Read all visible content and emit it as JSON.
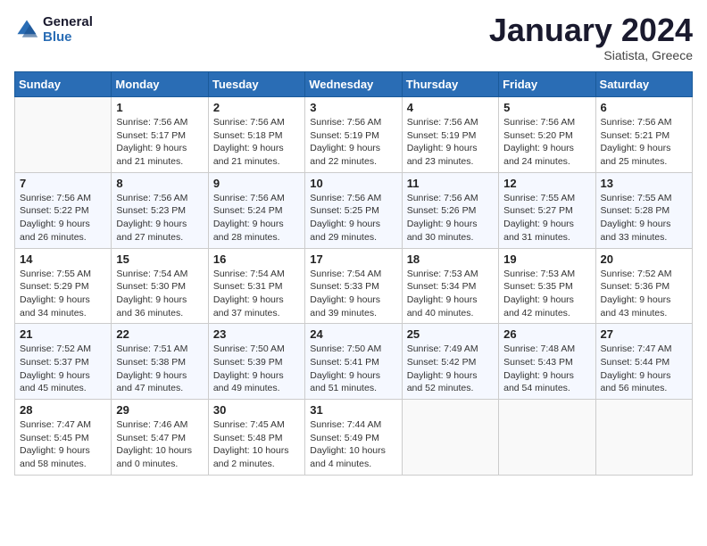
{
  "app": {
    "logo_line1": "General",
    "logo_line2": "Blue"
  },
  "title": "January 2024",
  "subtitle": "Siatista, Greece",
  "days_of_week": [
    "Sunday",
    "Monday",
    "Tuesday",
    "Wednesday",
    "Thursday",
    "Friday",
    "Saturday"
  ],
  "weeks": [
    [
      {
        "num": "",
        "sunrise": "",
        "sunset": "",
        "daylight": ""
      },
      {
        "num": "1",
        "sunrise": "Sunrise: 7:56 AM",
        "sunset": "Sunset: 5:17 PM",
        "daylight": "Daylight: 9 hours and 21 minutes."
      },
      {
        "num": "2",
        "sunrise": "Sunrise: 7:56 AM",
        "sunset": "Sunset: 5:18 PM",
        "daylight": "Daylight: 9 hours and 21 minutes."
      },
      {
        "num": "3",
        "sunrise": "Sunrise: 7:56 AM",
        "sunset": "Sunset: 5:19 PM",
        "daylight": "Daylight: 9 hours and 22 minutes."
      },
      {
        "num": "4",
        "sunrise": "Sunrise: 7:56 AM",
        "sunset": "Sunset: 5:19 PM",
        "daylight": "Daylight: 9 hours and 23 minutes."
      },
      {
        "num": "5",
        "sunrise": "Sunrise: 7:56 AM",
        "sunset": "Sunset: 5:20 PM",
        "daylight": "Daylight: 9 hours and 24 minutes."
      },
      {
        "num": "6",
        "sunrise": "Sunrise: 7:56 AM",
        "sunset": "Sunset: 5:21 PM",
        "daylight": "Daylight: 9 hours and 25 minutes."
      }
    ],
    [
      {
        "num": "7",
        "sunrise": "Sunrise: 7:56 AM",
        "sunset": "Sunset: 5:22 PM",
        "daylight": "Daylight: 9 hours and 26 minutes."
      },
      {
        "num": "8",
        "sunrise": "Sunrise: 7:56 AM",
        "sunset": "Sunset: 5:23 PM",
        "daylight": "Daylight: 9 hours and 27 minutes."
      },
      {
        "num": "9",
        "sunrise": "Sunrise: 7:56 AM",
        "sunset": "Sunset: 5:24 PM",
        "daylight": "Daylight: 9 hours and 28 minutes."
      },
      {
        "num": "10",
        "sunrise": "Sunrise: 7:56 AM",
        "sunset": "Sunset: 5:25 PM",
        "daylight": "Daylight: 9 hours and 29 minutes."
      },
      {
        "num": "11",
        "sunrise": "Sunrise: 7:56 AM",
        "sunset": "Sunset: 5:26 PM",
        "daylight": "Daylight: 9 hours and 30 minutes."
      },
      {
        "num": "12",
        "sunrise": "Sunrise: 7:55 AM",
        "sunset": "Sunset: 5:27 PM",
        "daylight": "Daylight: 9 hours and 31 minutes."
      },
      {
        "num": "13",
        "sunrise": "Sunrise: 7:55 AM",
        "sunset": "Sunset: 5:28 PM",
        "daylight": "Daylight: 9 hours and 33 minutes."
      }
    ],
    [
      {
        "num": "14",
        "sunrise": "Sunrise: 7:55 AM",
        "sunset": "Sunset: 5:29 PM",
        "daylight": "Daylight: 9 hours and 34 minutes."
      },
      {
        "num": "15",
        "sunrise": "Sunrise: 7:54 AM",
        "sunset": "Sunset: 5:30 PM",
        "daylight": "Daylight: 9 hours and 36 minutes."
      },
      {
        "num": "16",
        "sunrise": "Sunrise: 7:54 AM",
        "sunset": "Sunset: 5:31 PM",
        "daylight": "Daylight: 9 hours and 37 minutes."
      },
      {
        "num": "17",
        "sunrise": "Sunrise: 7:54 AM",
        "sunset": "Sunset: 5:33 PM",
        "daylight": "Daylight: 9 hours and 39 minutes."
      },
      {
        "num": "18",
        "sunrise": "Sunrise: 7:53 AM",
        "sunset": "Sunset: 5:34 PM",
        "daylight": "Daylight: 9 hours and 40 minutes."
      },
      {
        "num": "19",
        "sunrise": "Sunrise: 7:53 AM",
        "sunset": "Sunset: 5:35 PM",
        "daylight": "Daylight: 9 hours and 42 minutes."
      },
      {
        "num": "20",
        "sunrise": "Sunrise: 7:52 AM",
        "sunset": "Sunset: 5:36 PM",
        "daylight": "Daylight: 9 hours and 43 minutes."
      }
    ],
    [
      {
        "num": "21",
        "sunrise": "Sunrise: 7:52 AM",
        "sunset": "Sunset: 5:37 PM",
        "daylight": "Daylight: 9 hours and 45 minutes."
      },
      {
        "num": "22",
        "sunrise": "Sunrise: 7:51 AM",
        "sunset": "Sunset: 5:38 PM",
        "daylight": "Daylight: 9 hours and 47 minutes."
      },
      {
        "num": "23",
        "sunrise": "Sunrise: 7:50 AM",
        "sunset": "Sunset: 5:39 PM",
        "daylight": "Daylight: 9 hours and 49 minutes."
      },
      {
        "num": "24",
        "sunrise": "Sunrise: 7:50 AM",
        "sunset": "Sunset: 5:41 PM",
        "daylight": "Daylight: 9 hours and 51 minutes."
      },
      {
        "num": "25",
        "sunrise": "Sunrise: 7:49 AM",
        "sunset": "Sunset: 5:42 PM",
        "daylight": "Daylight: 9 hours and 52 minutes."
      },
      {
        "num": "26",
        "sunrise": "Sunrise: 7:48 AM",
        "sunset": "Sunset: 5:43 PM",
        "daylight": "Daylight: 9 hours and 54 minutes."
      },
      {
        "num": "27",
        "sunrise": "Sunrise: 7:47 AM",
        "sunset": "Sunset: 5:44 PM",
        "daylight": "Daylight: 9 hours and 56 minutes."
      }
    ],
    [
      {
        "num": "28",
        "sunrise": "Sunrise: 7:47 AM",
        "sunset": "Sunset: 5:45 PM",
        "daylight": "Daylight: 9 hours and 58 minutes."
      },
      {
        "num": "29",
        "sunrise": "Sunrise: 7:46 AM",
        "sunset": "Sunset: 5:47 PM",
        "daylight": "Daylight: 10 hours and 0 minutes."
      },
      {
        "num": "30",
        "sunrise": "Sunrise: 7:45 AM",
        "sunset": "Sunset: 5:48 PM",
        "daylight": "Daylight: 10 hours and 2 minutes."
      },
      {
        "num": "31",
        "sunrise": "Sunrise: 7:44 AM",
        "sunset": "Sunset: 5:49 PM",
        "daylight": "Daylight: 10 hours and 4 minutes."
      },
      {
        "num": "",
        "sunrise": "",
        "sunset": "",
        "daylight": ""
      },
      {
        "num": "",
        "sunrise": "",
        "sunset": "",
        "daylight": ""
      },
      {
        "num": "",
        "sunrise": "",
        "sunset": "",
        "daylight": ""
      }
    ]
  ]
}
